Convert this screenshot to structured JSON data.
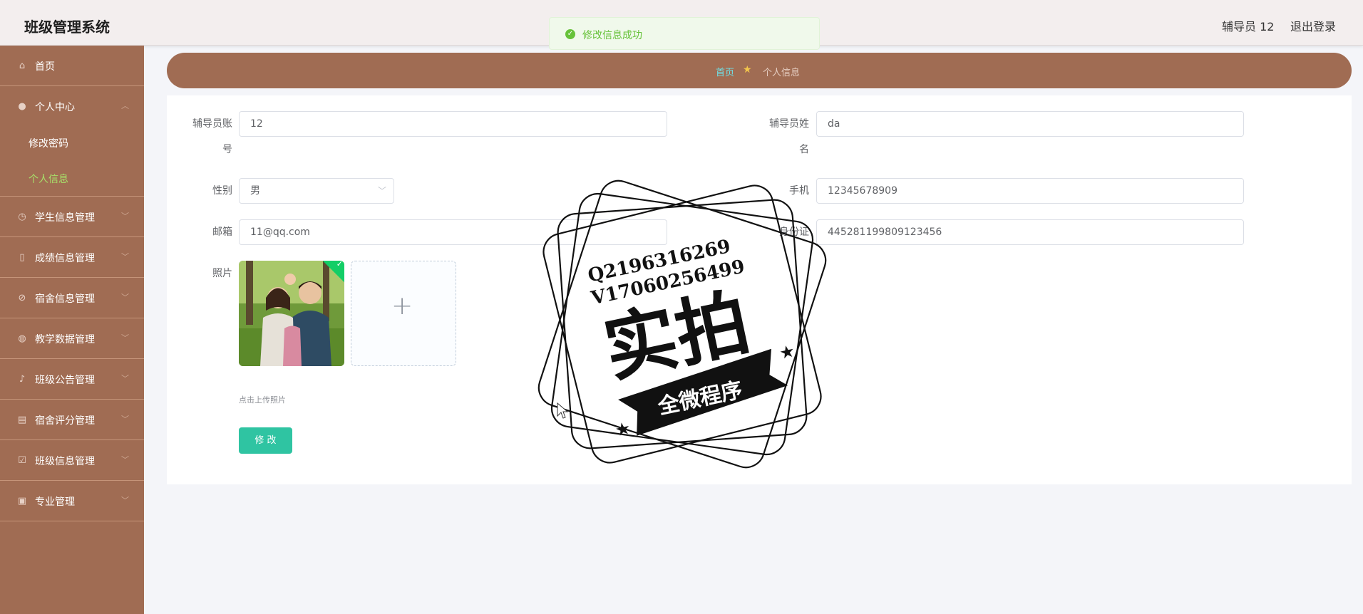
{
  "header": {
    "app_title": "班级管理系统",
    "user_name": "辅导员 12",
    "logout_label": "退出登录"
  },
  "toast": {
    "message": "修改信息成功",
    "status_color": "#67c23a"
  },
  "sidebar": {
    "items": [
      {
        "label": "首页",
        "icon": "home-icon"
      },
      {
        "label": "个人中心",
        "icon": "user-icon",
        "expanded": true
      },
      {
        "label": "学生信息管理",
        "icon": "clock-icon"
      },
      {
        "label": "成绩信息管理",
        "icon": "phone-icon"
      },
      {
        "label": "宿舍信息管理",
        "icon": "ban-icon"
      },
      {
        "label": "教学数据管理",
        "icon": "globe-icon"
      },
      {
        "label": "班级公告管理",
        "icon": "mic-icon"
      },
      {
        "label": "宿舍评分管理",
        "icon": "briefcase-icon"
      },
      {
        "label": "班级信息管理",
        "icon": "checkbox-icon"
      },
      {
        "label": "专业管理",
        "icon": "clipboard-icon"
      }
    ],
    "sub_items": [
      {
        "label": "修改密码",
        "active": false
      },
      {
        "label": "个人信息",
        "active": true
      }
    ],
    "active_color": "#a7e06a"
  },
  "breadcrumb": {
    "home": "首页",
    "current": "个人信息"
  },
  "form": {
    "account_label": "辅导员账号",
    "account_value": "12",
    "name_label": "辅导员姓名",
    "name_value": "da",
    "gender_label": "性别",
    "gender_value": "男",
    "phone_label": "手机",
    "phone_value": "12345678909",
    "email_label": "邮箱",
    "email_value": "11@qq.com",
    "id_label": "身份证",
    "id_value": "445281199809123456",
    "photo_label": "照片",
    "upload_hint": "点击上传照片",
    "submit_label": "修 改"
  },
  "watermark": {
    "line1": "Q2196316269",
    "line2": "V17060256499",
    "big_text": "实拍",
    "ribbon_text": "全微程序"
  },
  "colors": {
    "brand": "#a06c53",
    "accent": "#2fc4a2"
  }
}
